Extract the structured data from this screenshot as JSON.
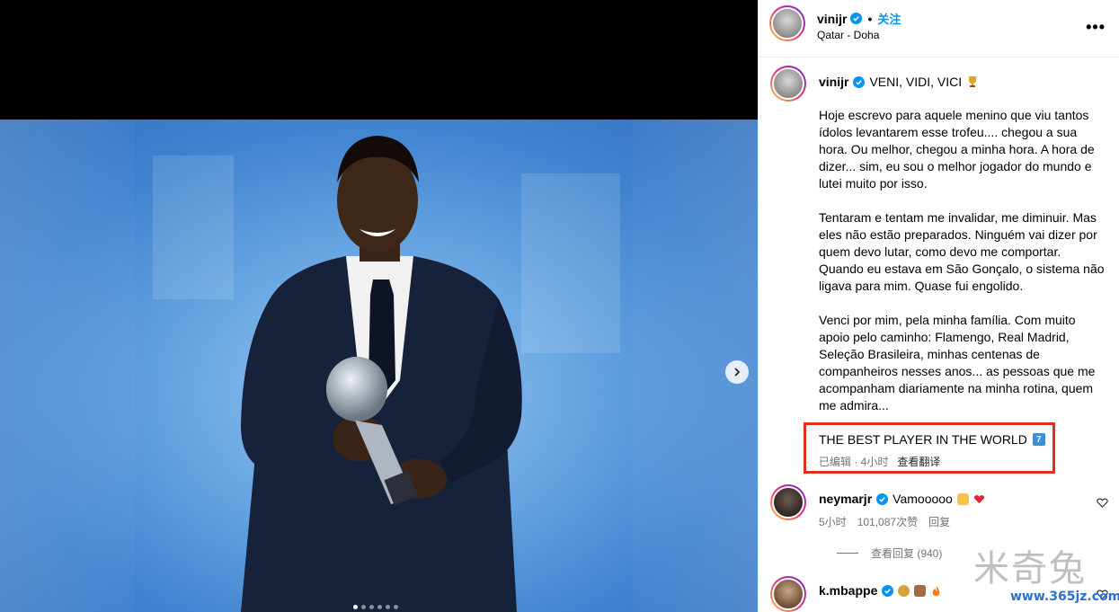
{
  "header": {
    "username": "vinijr",
    "separator": "•",
    "follow_label": "关注",
    "location": "Qatar - Doha",
    "more_label": "•••"
  },
  "post": {
    "username": "vinijr",
    "title": "VENI, VIDI, VICI",
    "paragraphs": [
      "Hoje escrevo para aquele menino que viu tantos ídolos levantarem esse trofeu.... chegou a sua hora. Ou melhor, chegou a minha hora. A hora de dizer... sim, eu sou o melhor jogador do mundo e lutei muito por isso.",
      "Tentaram e tentam me invalidar, me diminuir. Mas eles não estão preparados. Ninguém vai dizer por quem devo lutar, como devo me comportar. Quando eu estava em São Gonçalo, o sistema não ligava para mim. Quase fui engolido.",
      "Venci por mim, pela minha família. Com muito apoio pelo caminho: Flamengo, Real Madrid, Seleção Brasileira, minhas centenas de companheiros nesses anos... as pessoas que me acompanham diariamente na minha rotina, quem me admira..."
    ],
    "best_line": "THE BEST PLAYER IN THE WORLD",
    "best_badge": "7",
    "edited_time": "已编辑 · 4小时",
    "translate_label": "查看翻译"
  },
  "comments": [
    {
      "username": "neymarjr",
      "text": "Vamooooo",
      "time": "5小时",
      "likes": "101,087次赞",
      "reply_label": "回复",
      "view_replies": "查看回复 (940)"
    },
    {
      "username": "k.mbappe"
    }
  ],
  "carousel": {
    "count": 6,
    "active": 0
  },
  "watermark": {
    "text": "米奇兔",
    "url": "www.365jz.com"
  },
  "colors": {
    "accent": "#0095f6",
    "highlight_box": "#e0301e",
    "verified": "#0095f6"
  }
}
